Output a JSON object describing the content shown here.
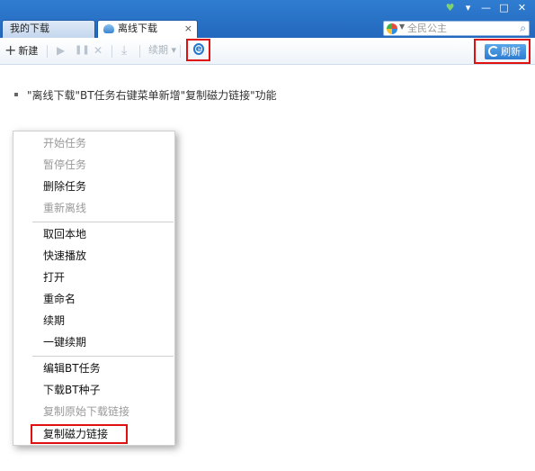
{
  "tabs": [
    {
      "label": "我的下载",
      "active": false
    },
    {
      "label": "离线下载",
      "active": true
    }
  ],
  "tab_close": "×",
  "window_buttons": [
    "♥",
    "▾",
    "—",
    "□",
    "✕"
  ],
  "search": {
    "placeholder": "全民公主",
    "icon": "search-icon"
  },
  "toolbar": {
    "new_label": "新建",
    "renew_label": "续期",
    "renew_caret": "▾",
    "refresh_label": "刷新",
    "play_glyph": "▶",
    "pause_glyph": "❚❚",
    "delete_glyph": "✕",
    "download_glyph": "⤓"
  },
  "note": "\"离线下载\"BT任务右键菜单新增\"复制磁力链接\"功能",
  "context_menu": {
    "items": [
      {
        "label": "开始任务",
        "enabled": false
      },
      {
        "label": "暂停任务",
        "enabled": false
      },
      {
        "label": "删除任务",
        "enabled": true
      },
      {
        "label": "重新离线",
        "enabled": false
      },
      {
        "label": "取回本地",
        "enabled": true
      },
      {
        "label": "快速播放",
        "enabled": true
      },
      {
        "label": "打开",
        "enabled": true
      },
      {
        "label": "重命名",
        "enabled": true
      },
      {
        "label": "续期",
        "enabled": true
      },
      {
        "label": "一键续期",
        "enabled": true
      },
      {
        "label": "编辑BT任务",
        "enabled": true
      },
      {
        "label": "下载BT种子",
        "enabled": true
      },
      {
        "label": "复制原始下载链接",
        "enabled": false
      },
      {
        "label": "复制磁力链接",
        "enabled": true
      }
    ]
  },
  "colors": {
    "titlebar": "#2f7dd1",
    "highlight_box": "#e01010",
    "refresh_button": "#2c7bd0"
  }
}
